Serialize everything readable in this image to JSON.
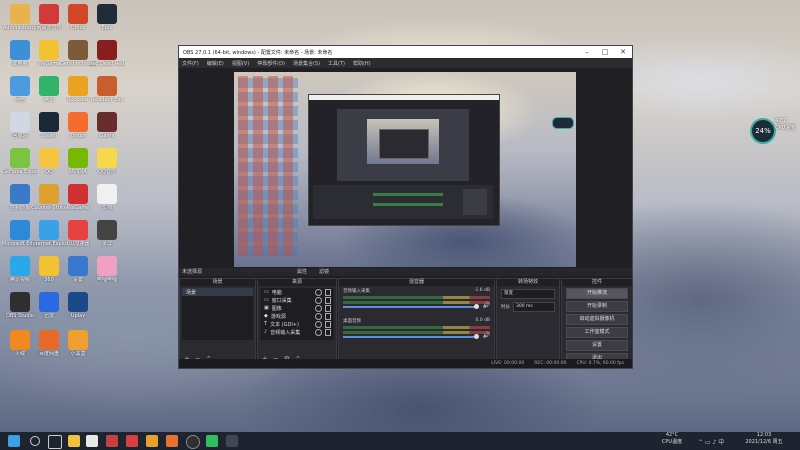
{
  "desktop_icons": [
    {
      "label": "Administrator",
      "color": "#e8b34a",
      "col": 0,
      "row": 0
    },
    {
      "label": "网易云音乐",
      "color": "#d23a3a",
      "col": 1,
      "row": 0
    },
    {
      "label": "Office",
      "color": "#d24726",
      "col": 2,
      "row": 0
    },
    {
      "label": "Epic",
      "color": "#222b3a",
      "col": 3,
      "row": 0
    },
    {
      "label": "此电脑",
      "color": "#3d8fd6",
      "col": 0,
      "row": 1
    },
    {
      "label": "WeGame",
      "color": "#f2c230",
      "col": 1,
      "row": 1
    },
    {
      "label": "Genshin Impact",
      "color": "#7c5a3a",
      "col": 2,
      "row": 1
    },
    {
      "label": "Red Dead Redemption",
      "color": "#8a1d1d",
      "col": 3,
      "row": 1
    },
    {
      "label": "网络",
      "color": "#4a9be0",
      "col": 0,
      "row": 2
    },
    {
      "label": "腾讯",
      "color": "#31b36c",
      "col": 1,
      "row": 2
    },
    {
      "label": "Rockstar",
      "color": "#e8a322",
      "col": 2,
      "row": 2
    },
    {
      "label": "Resident Evil",
      "color": "#c85d2e",
      "col": 3,
      "row": 2
    },
    {
      "label": "回收站",
      "color": "#cfd8e4",
      "col": 0,
      "row": 3
    },
    {
      "label": "Steam",
      "color": "#1b2838",
      "col": 1,
      "row": 3
    },
    {
      "label": "Origin",
      "color": "#f56c2d",
      "col": 2,
      "row": 3
    },
    {
      "label": "Game",
      "color": "#6a2d2d",
      "col": 3,
      "row": 3
    },
    {
      "label": "GeForce Experience",
      "color": "#7cc243",
      "col": 0,
      "row": 4
    },
    {
      "label": "QQ",
      "color": "#f5c542",
      "col": 1,
      "row": 4
    },
    {
      "label": "NVIDIA",
      "color": "#76b900",
      "col": 2,
      "row": 4
    },
    {
      "label": "QQ音乐",
      "color": "#f7d84a",
      "col": 3,
      "row": 4
    },
    {
      "label": "控制面板",
      "color": "#3a7ac8",
      "col": 0,
      "row": 5
    },
    {
      "label": "Counter-Strike",
      "color": "#e0a030",
      "col": 1,
      "row": 5
    },
    {
      "label": "WeGame",
      "color": "#d03030",
      "col": 2,
      "row": 5
    },
    {
      "label": "文档",
      "color": "#f0f0f0",
      "col": 3,
      "row": 5
    },
    {
      "label": "Microsoft Edge",
      "color": "#2a8ad8",
      "col": 0,
      "row": 6
    },
    {
      "label": "Internet Explorer",
      "color": "#3aa0e8",
      "col": 1,
      "row": 6
    },
    {
      "label": "UU加速器",
      "color": "#e84040",
      "col": 2,
      "row": 6
    },
    {
      "label": "录屏",
      "color": "#444",
      "col": 3,
      "row": 6
    },
    {
      "label": "腾讯视频",
      "color": "#2aa8e8",
      "col": 0,
      "row": 7
    },
    {
      "label": "360",
      "color": "#f2c230",
      "col": 1,
      "row": 7
    },
    {
      "label": "设置",
      "color": "#3a78d0",
      "col": 2,
      "row": 7
    },
    {
      "label": "哔哩哔哩",
      "color": "#f0a0c0",
      "col": 3,
      "row": 7
    },
    {
      "label": "OBS Studio",
      "color": "#302e31",
      "col": 0,
      "row": 8
    },
    {
      "label": "迅雷",
      "color": "#2a6ae0",
      "col": 1,
      "row": 8
    },
    {
      "label": "Uplay",
      "color": "#1a4a8a",
      "col": 2,
      "row": 8
    },
    {
      "label": "火绒",
      "color": "#f08a20",
      "col": 0,
      "row": 9
    },
    {
      "label": "百度网盘",
      "color": "#e86a2a",
      "col": 1,
      "row": 9
    },
    {
      "label": "小黑盒",
      "color": "#f0a030",
      "col": 2,
      "row": 9
    }
  ],
  "obs": {
    "title": "OBS 27.0.1 (64-bit, windows) - 配置文件: 未命名 - 场景: 未命名",
    "menu": [
      "文件(F)",
      "编辑(E)",
      "视图(V)",
      "停靠部件(D)",
      "场景集合(S)",
      "工具(T)",
      "帮助(H)"
    ],
    "scene_bar_label": "未选择源",
    "scene_bar_props": "属性",
    "scene_bar_filters": "滤镜",
    "docks": {
      "scenes": {
        "title": "场景",
        "items": [
          "场景"
        ]
      },
      "sources": {
        "title": "来源",
        "items": [
          "电脑",
          "窗口采集",
          "图像",
          "游戏源",
          "文本 (GDI+)",
          "音频输入采集"
        ]
      },
      "mixer": {
        "title": "混音器",
        "tracks": [
          {
            "name": "音频输入采集",
            "db": "-1.6 dB"
          },
          {
            "name": "桌面音频",
            "db": "0.0 dB"
          }
        ]
      },
      "transitions": {
        "title": "转场特效",
        "type": "渐变",
        "duration_label": "时长",
        "duration": "300 ms"
      },
      "controls": {
        "title": "控件",
        "buttons": [
          "开始推流",
          "开始录制",
          "启动虚拟摄像机",
          "工作室模式",
          "设置",
          "退出"
        ],
        "active": 0
      }
    },
    "status": {
      "live": "LIVE: 00:00:00",
      "rec": "REC: 00:00:00",
      "cpu": "CPU: 0.7%, 60.00 fps"
    }
  },
  "widget": {
    "value": "24",
    "unit": "%",
    "temp": "42°C",
    "label": "CPU温度"
  },
  "taskbar": {
    "weather_temp": "42°C",
    "weather_label": "CPU温度",
    "time": "12:03",
    "date": "2021/12/6 周五"
  },
  "colors": {
    "taskbar": "#1e2330",
    "obs_bg": "#202024",
    "accent": "#5a90e0"
  }
}
